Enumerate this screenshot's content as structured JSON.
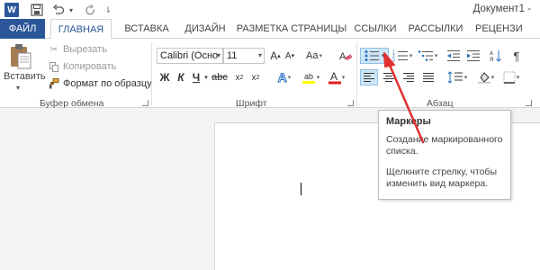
{
  "title_bar": {
    "app_icon_letter": "W",
    "document_title": "Документ1 -"
  },
  "tabs": [
    {
      "label": "ФАЙЛ"
    },
    {
      "label": "ГЛАВНАЯ"
    },
    {
      "label": "ВСТАВКА"
    },
    {
      "label": "ДИЗАЙН"
    },
    {
      "label": "РАЗМЕТКА СТРАНИЦЫ"
    },
    {
      "label": "ССЫЛКИ"
    },
    {
      "label": "РАССЫЛКИ"
    },
    {
      "label": "РЕЦЕНЗИ"
    }
  ],
  "clipboard": {
    "paste_label": "Вставить",
    "cut_label": "Вырезать",
    "copy_label": "Копировать",
    "format_painter_label": "Формат по образцу",
    "group_label": "Буфер обмена"
  },
  "font": {
    "font_name": "Calibri (Осно",
    "font_size": "11",
    "bold": "Ж",
    "italic": "К",
    "underline": "Ч",
    "group_label": "Шрифт"
  },
  "paragraph": {
    "group_label": "Абзац",
    "pilcrow": "¶"
  },
  "tooltip": {
    "title": "Маркеры",
    "line1": "Создание маркированного списка.",
    "line2": "Щелкните стрелку, чтобы изменить вид маркера."
  },
  "colors": {
    "accent": "#2b579a",
    "arrow": "#e03131",
    "highlight": "#cde6f7"
  }
}
